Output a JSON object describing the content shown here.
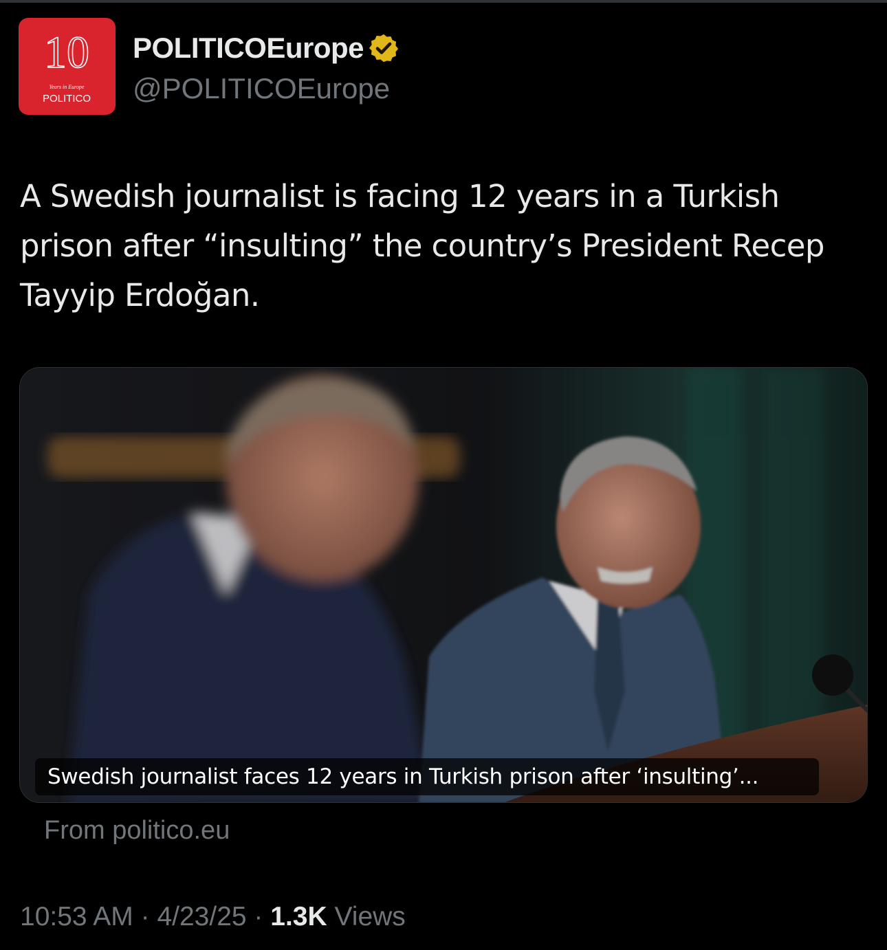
{
  "author": {
    "display_name": "POLITICOEurope",
    "handle": "@POLITICOEurope",
    "verified": true,
    "verified_badge_color": "#e2b719",
    "avatar": {
      "number": "10",
      "tagline": "Years in Europe",
      "brand": "POLITICO",
      "background": "#d9232d"
    }
  },
  "tweet": {
    "text": "A Swedish journalist is facing 12 years in a Turkish prison after “insulting” the country’s President Recep Tayyip Erdoğan."
  },
  "link_card": {
    "title": "Swedish journalist faces 12 years in Turkish prison after ‘insulting’...",
    "source": "From politico.eu"
  },
  "meta": {
    "time": "10:53 AM",
    "separator": " · ",
    "date": "4/23/25",
    "views_count": "1.3K",
    "views_label": " Views"
  }
}
